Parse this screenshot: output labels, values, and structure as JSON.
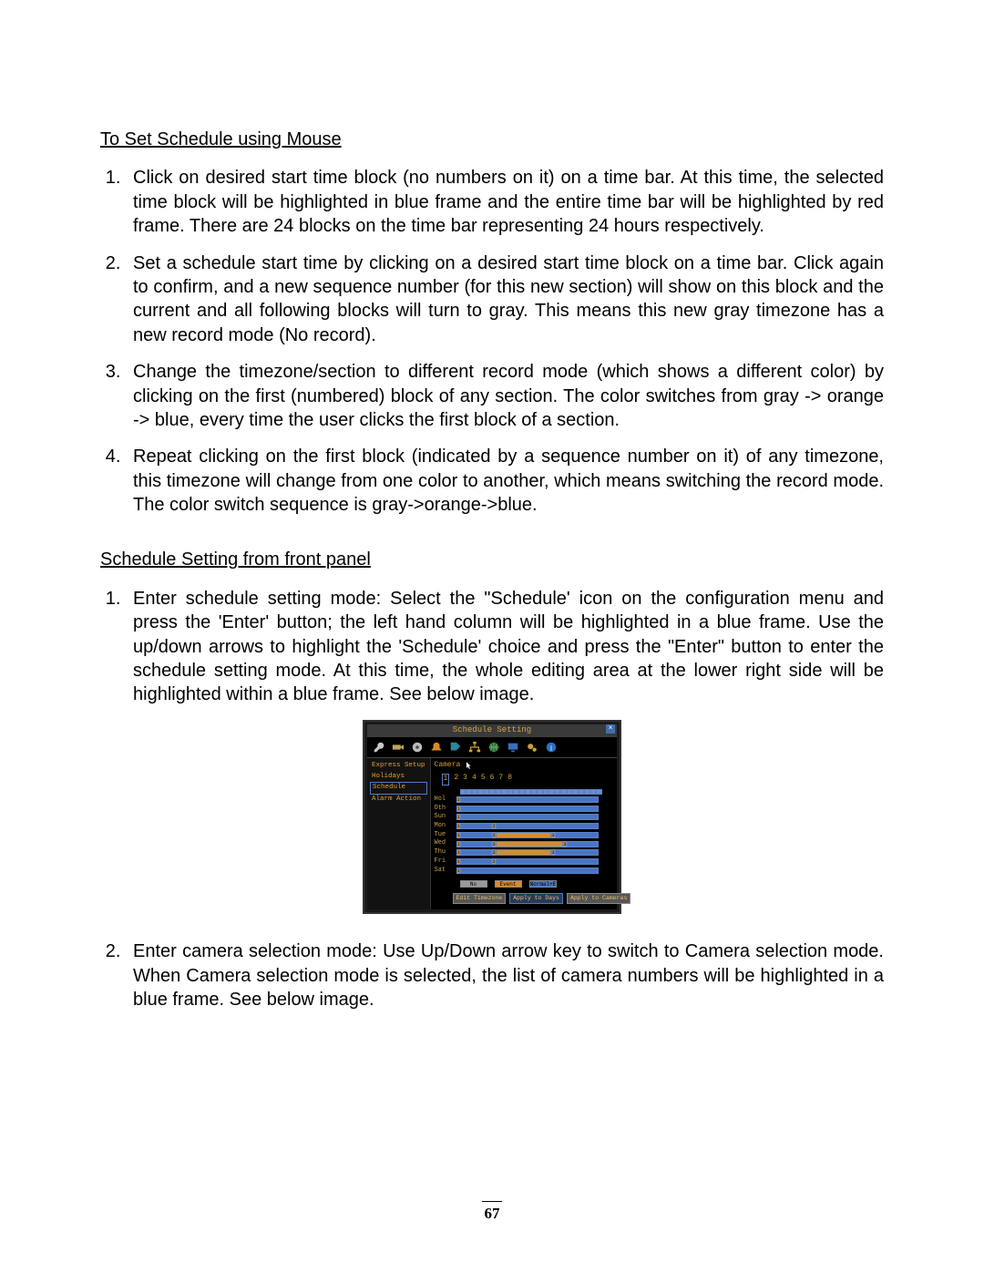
{
  "section_a": {
    "heading": "To Set Schedule using Mouse",
    "items": [
      "Click on desired start time block (no numbers on it) on a time bar. At this time, the selected time block will be highlighted in blue frame and the entire time bar will be highlighted by red frame. There are 24 blocks on the time bar representing 24 hours respectively.",
      "Set a schedule start time by clicking on a desired start time block on a time bar.  Click again to confirm, and a new sequence number (for this new section) will show on this block and the current and all following blocks will turn to gray. This means this new gray timezone has a new record mode (No record).",
      "Change the timezone/section to different record mode (which shows a different color) by clicking on the first (numbered) block of any section. The color switches from gray -> orange -> blue, every time the user clicks the first block of a section.",
      "Repeat clicking on the first block (indicated by a sequence number on it) of any timezone, this timezone will change from one color to another, which means switching the record mode. The color switch sequence is gray->orange->blue."
    ]
  },
  "section_b": {
    "heading": "Schedule Setting from front panel",
    "items": [
      "Enter schedule setting mode: Select the \"Schedule' icon on the configuration menu and press the 'Enter' button; the left hand column will be highlighted in a blue frame. Use the up/down arrows to highlight the 'Schedule' choice and press the \"Enter\" button to enter the schedule setting mode. At this time, the whole editing area at the lower right side will be highlighted within a blue frame. See below image.",
      "Enter camera selection mode: Use Up/Down arrow key to switch to Camera selection mode. When Camera selection mode is selected, the list of camera numbers will be highlighted in a blue frame. See below image."
    ]
  },
  "figure": {
    "title": "Schedule Setting",
    "close": "×",
    "icons": [
      "wrench-icon",
      "camera-icon",
      "reel-icon",
      "bell-icon",
      "tag-icon",
      "network-icon",
      "globe-icon",
      "monitor-icon",
      "gears-icon",
      "info-icon"
    ],
    "sidebar": [
      "Express Setup",
      "Holidays",
      "Schedule",
      "Alarm Action"
    ],
    "sidebar_active_index": 2,
    "camera_label": "Camera",
    "camera_numbers": [
      "1",
      "2",
      "3",
      "4",
      "5",
      "6",
      "7",
      "8"
    ],
    "hours_count": 24,
    "days": [
      "Hol",
      "Oth",
      "Sun",
      "Mon",
      "Tue",
      "Wed",
      "Thu",
      "Fri",
      "Sat"
    ],
    "legend": {
      "no_record": "No Record",
      "event_only": "Event Only",
      "normal_event": "Normal+Event"
    },
    "buttons": {
      "edit": "Edit Timezone",
      "apply_days": "Apply to Days",
      "apply_cameras": "Apply to Cameras"
    }
  },
  "page_number": "67"
}
